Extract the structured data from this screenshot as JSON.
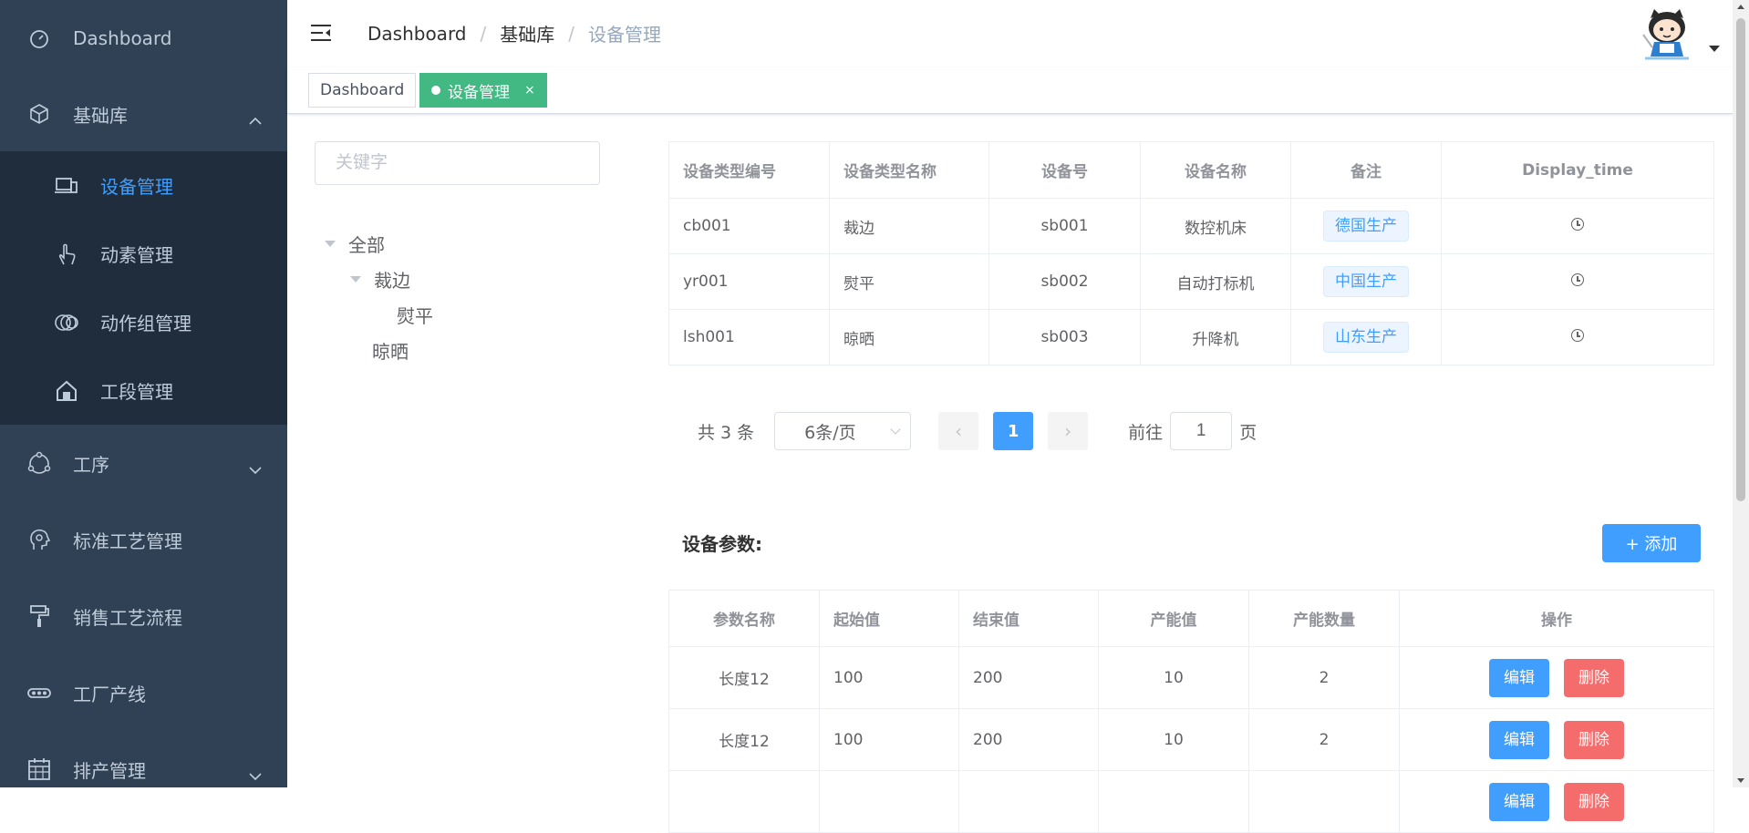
{
  "sidebar": {
    "dashboard": "Dashboard",
    "base": "基础库",
    "sub": [
      {
        "label": "设备管理",
        "icon": "device-icon"
      },
      {
        "label": "动素管理",
        "icon": "hand-icon"
      },
      {
        "label": "动作组管理",
        "icon": "rings-icon"
      },
      {
        "label": "工段管理",
        "icon": "house-icon"
      }
    ],
    "process": "工序",
    "std": "标准工艺管理",
    "sales": "销售工艺流程",
    "factory": "工厂产线",
    "schedule": "排产管理"
  },
  "header": {
    "crumbs": [
      "Dashboard",
      "基础库",
      "设备管理"
    ]
  },
  "tags": {
    "dashboard": "Dashboard",
    "active": "设备管理",
    "close": "×"
  },
  "search": {
    "placeholder": "关键字"
  },
  "tree": {
    "all": "全部",
    "caibian": "裁边",
    "yunping": "熨平",
    "liangshai": "晾晒"
  },
  "deviceTable": {
    "headers": [
      "设备类型编号",
      "设备类型名称",
      "设备号",
      "设备名称",
      "备注",
      "Display_time"
    ],
    "rows": [
      [
        "cb001",
        "裁边",
        "sb001",
        "数控机床",
        "德国生产"
      ],
      [
        "yr001",
        "熨平",
        "sb002",
        "自动打标机",
        "中国生产"
      ],
      [
        "lsh001",
        "晾晒",
        "sb003",
        "升降机",
        "山东生产"
      ]
    ]
  },
  "pager": {
    "total": "共 3 条",
    "size": "6条/页",
    "prev": "‹",
    "current": "1",
    "next": "›",
    "goto": "前往",
    "gotoValue": "1",
    "page": "页"
  },
  "params": {
    "title": "设备参数:",
    "add": "+ 添加",
    "headers": [
      "参数名称",
      "起始值",
      "结束值",
      "产能值",
      "产能数量",
      "操作"
    ],
    "rows": [
      [
        "长度12",
        "100",
        "200",
        "10",
        "2"
      ],
      [
        "长度12",
        "100",
        "200",
        "10",
        "2"
      ],
      [
        "",
        "",
        "",
        "",
        ""
      ]
    ],
    "edit": "编辑",
    "del": "删除"
  },
  "colors": {
    "sidebar": "#304156",
    "submenu": "#1f2d3d",
    "active": "#409eff",
    "tag": "#42b983",
    "danger": "#f56c6c"
  }
}
